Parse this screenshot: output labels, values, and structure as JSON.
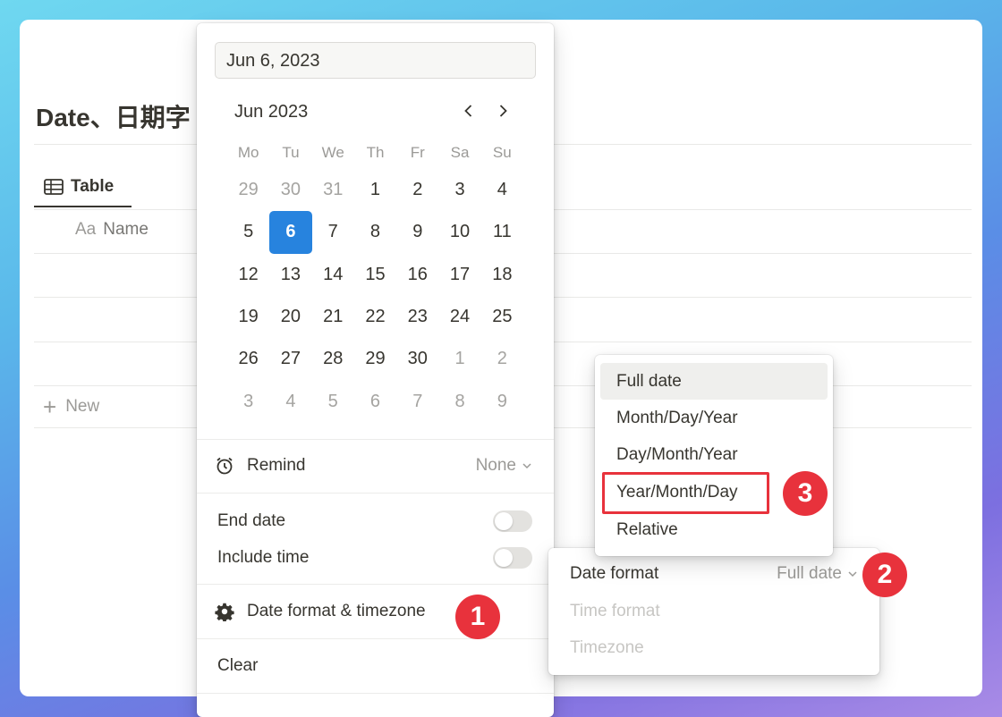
{
  "page": {
    "title": "Date、日期字",
    "view_tab": "Table",
    "column_header": "Name",
    "column_icon_text": "Aa",
    "new_row_label": "New"
  },
  "picker": {
    "date_value": "Jun 6, 2023",
    "month_label": "Jun 2023",
    "weekdays": [
      "Mo",
      "Tu",
      "We",
      "Th",
      "Fr",
      "Sa",
      "Su"
    ],
    "weeks": [
      [
        {
          "d": "29",
          "m": true
        },
        {
          "d": "30",
          "m": true
        },
        {
          "d": "31",
          "m": true
        },
        {
          "d": "1"
        },
        {
          "d": "2"
        },
        {
          "d": "3"
        },
        {
          "d": "4"
        }
      ],
      [
        {
          "d": "5"
        },
        {
          "d": "6",
          "s": true
        },
        {
          "d": "7"
        },
        {
          "d": "8"
        },
        {
          "d": "9"
        },
        {
          "d": "10"
        },
        {
          "d": "11"
        }
      ],
      [
        {
          "d": "12"
        },
        {
          "d": "13"
        },
        {
          "d": "14"
        },
        {
          "d": "15"
        },
        {
          "d": "16"
        },
        {
          "d": "17"
        },
        {
          "d": "18"
        }
      ],
      [
        {
          "d": "19"
        },
        {
          "d": "20"
        },
        {
          "d": "21"
        },
        {
          "d": "22"
        },
        {
          "d": "23"
        },
        {
          "d": "24"
        },
        {
          "d": "25"
        }
      ],
      [
        {
          "d": "26"
        },
        {
          "d": "27"
        },
        {
          "d": "28"
        },
        {
          "d": "29"
        },
        {
          "d": "30"
        },
        {
          "d": "1",
          "m": true
        },
        {
          "d": "2",
          "m": true
        }
      ],
      [
        {
          "d": "3",
          "m": true
        },
        {
          "d": "4",
          "m": true
        },
        {
          "d": "5",
          "m": true
        },
        {
          "d": "6",
          "m": true
        },
        {
          "d": "7",
          "m": true
        },
        {
          "d": "8",
          "m": true
        },
        {
          "d": "9",
          "m": true
        }
      ]
    ],
    "remind_label": "Remind",
    "remind_value": "None",
    "end_date_label": "End date",
    "include_time_label": "Include time",
    "date_format_label": "Date format & timezone",
    "clear_label": "Clear"
  },
  "submenu": {
    "date_format_label": "Date format",
    "date_format_value": "Full date",
    "time_format_label": "Time format",
    "timezone_label": "Timezone"
  },
  "dropdown": {
    "options": [
      "Full date",
      "Month/Day/Year",
      "Day/Month/Year",
      "Year/Month/Day",
      "Relative"
    ]
  },
  "annotations": {
    "step1": "1",
    "step2": "2",
    "step3": "3",
    "badge_color": "#e8323c"
  },
  "colors": {
    "accent": "#2783de",
    "text": "#37352f",
    "muted": "#9b9a97"
  }
}
